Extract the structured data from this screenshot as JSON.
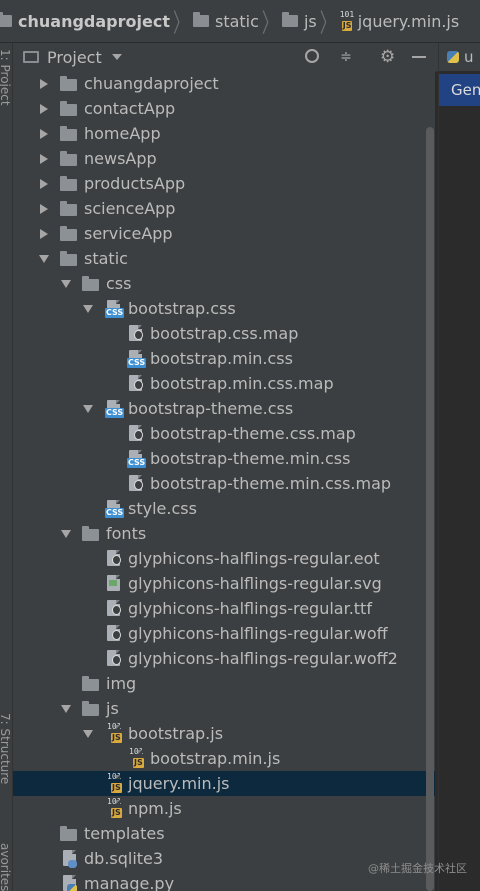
{
  "breadcrumb": {
    "items": [
      {
        "label": "chuangdaproject",
        "icon": "folder-icon"
      },
      {
        "label": "static",
        "icon": "folder-icon"
      },
      {
        "label": "js",
        "icon": "folder-icon"
      },
      {
        "label": "jquery.min.js",
        "icon": "js-file-icon"
      }
    ]
  },
  "side_tabs": {
    "project": "1: Project",
    "structure": "7: Structure",
    "favorites": "avorites"
  },
  "panel": {
    "title": "Project",
    "actions": [
      "locate-icon",
      "collapse-icon",
      "gear-icon",
      "minimize-icon"
    ]
  },
  "tree": [
    {
      "label": "chuangdaproject",
      "level": 0,
      "type": "folder",
      "state": "collapsed"
    },
    {
      "label": "contactApp",
      "level": 0,
      "type": "folder",
      "state": "collapsed"
    },
    {
      "label": "homeApp",
      "level": 0,
      "type": "folder",
      "state": "collapsed"
    },
    {
      "label": "newsApp",
      "level": 0,
      "type": "folder",
      "state": "collapsed"
    },
    {
      "label": "productsApp",
      "level": 0,
      "type": "folder",
      "state": "collapsed"
    },
    {
      "label": "scienceApp",
      "level": 0,
      "type": "folder",
      "state": "collapsed"
    },
    {
      "label": "serviceApp",
      "level": 0,
      "type": "folder",
      "state": "collapsed"
    },
    {
      "label": "static",
      "level": 0,
      "type": "folder",
      "state": "expanded"
    },
    {
      "label": "css",
      "level": 1,
      "type": "folder",
      "state": "expanded"
    },
    {
      "label": "bootstrap.css",
      "level": 2,
      "type": "css",
      "state": "expanded"
    },
    {
      "label": "bootstrap.css.map",
      "level": 3,
      "type": "map",
      "state": "none"
    },
    {
      "label": "bootstrap.min.css",
      "level": 3,
      "type": "css",
      "state": "none"
    },
    {
      "label": "bootstrap.min.css.map",
      "level": 3,
      "type": "map",
      "state": "none"
    },
    {
      "label": "bootstrap-theme.css",
      "level": 2,
      "type": "css",
      "state": "expanded"
    },
    {
      "label": "bootstrap-theme.css.map",
      "level": 3,
      "type": "map",
      "state": "none"
    },
    {
      "label": "bootstrap-theme.min.css",
      "level": 3,
      "type": "css",
      "state": "none"
    },
    {
      "label": "bootstrap-theme.min.css.map",
      "level": 3,
      "type": "map",
      "state": "none"
    },
    {
      "label": "style.css",
      "level": 2,
      "type": "css",
      "state": "none"
    },
    {
      "label": "fonts",
      "level": 1,
      "type": "folder",
      "state": "expanded"
    },
    {
      "label": "glyphicons-halflings-regular.eot",
      "level": 2,
      "type": "map",
      "state": "none"
    },
    {
      "label": "glyphicons-halflings-regular.svg",
      "level": 2,
      "type": "image",
      "state": "none"
    },
    {
      "label": "glyphicons-halflings-regular.ttf",
      "level": 2,
      "type": "map",
      "state": "none"
    },
    {
      "label": "glyphicons-halflings-regular.woff",
      "level": 2,
      "type": "map",
      "state": "none"
    },
    {
      "label": "glyphicons-halflings-regular.woff2",
      "level": 2,
      "type": "map",
      "state": "none"
    },
    {
      "label": "img",
      "level": 1,
      "type": "folder",
      "state": "none"
    },
    {
      "label": "js",
      "level": 1,
      "type": "folder",
      "state": "expanded"
    },
    {
      "label": "bootstrap.js",
      "level": 2,
      "type": "js",
      "state": "expanded"
    },
    {
      "label": "bootstrap.min.js",
      "level": 3,
      "type": "js",
      "state": "none"
    },
    {
      "label": "jquery.min.js",
      "level": 2,
      "type": "js",
      "state": "none",
      "selected": true
    },
    {
      "label": "npm.js",
      "level": 2,
      "type": "js",
      "state": "none"
    },
    {
      "label": "templates",
      "level": 0,
      "type": "folder",
      "state": "none"
    },
    {
      "label": "db.sqlite3",
      "level": 0,
      "type": "db",
      "state": "none"
    },
    {
      "label": "manage.py",
      "level": 0,
      "type": "py",
      "state": "none"
    }
  ],
  "editor": {
    "tab_label": "u",
    "gen_label": "Gen"
  },
  "watermark": "@稀土掘金技术社区",
  "colors": {
    "background": "#3c3f41",
    "selection": "#0d293e",
    "text": "#bbbbbb",
    "editor_highlight": "#214283"
  }
}
